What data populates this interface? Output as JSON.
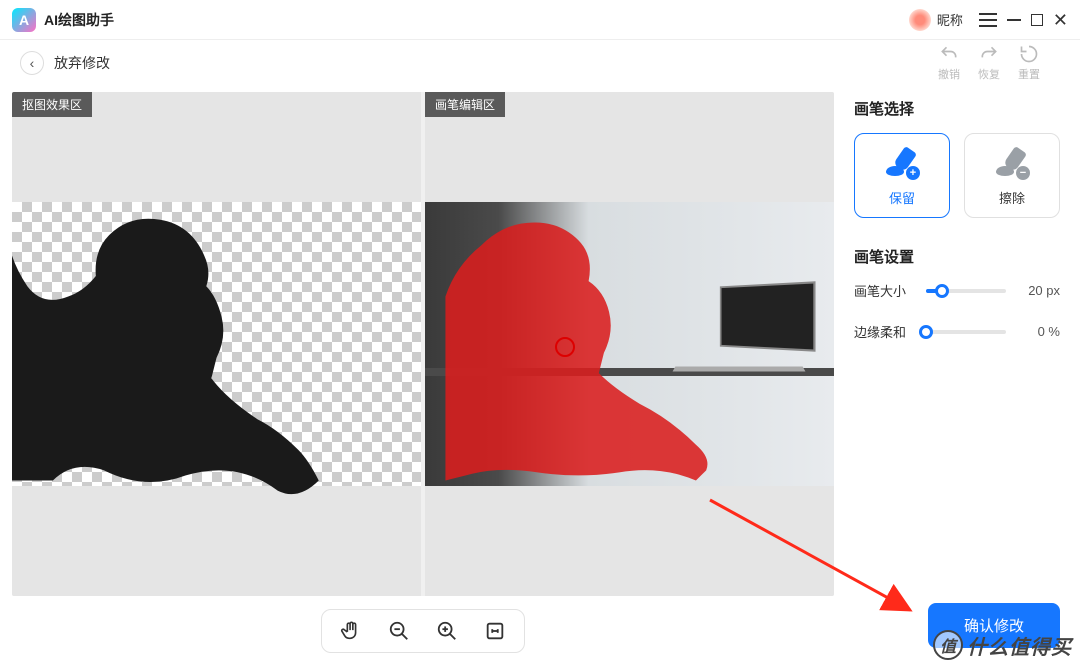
{
  "app": {
    "title": "AI绘图助手",
    "logo_letter": "A"
  },
  "user": {
    "nickname": "昵称"
  },
  "header": {
    "back_label": "放弃修改"
  },
  "actions": {
    "undo": "撤销",
    "redo": "恢复",
    "reset": "重置"
  },
  "canvas": {
    "left_tag": "抠图效果区",
    "right_tag": "画笔编辑区"
  },
  "sidebar": {
    "brush_title": "画笔选择",
    "keep_label": "保留",
    "erase_label": "擦除",
    "settings_title": "画笔设置",
    "size_label": "画笔大小",
    "size_value": "20 px",
    "size_percent": 20,
    "soft_label": "边缘柔和",
    "soft_value": "0 %",
    "soft_percent": 0
  },
  "confirm": {
    "label": "确认修改"
  },
  "watermark": {
    "circle": "值",
    "text": "什么值得买"
  }
}
